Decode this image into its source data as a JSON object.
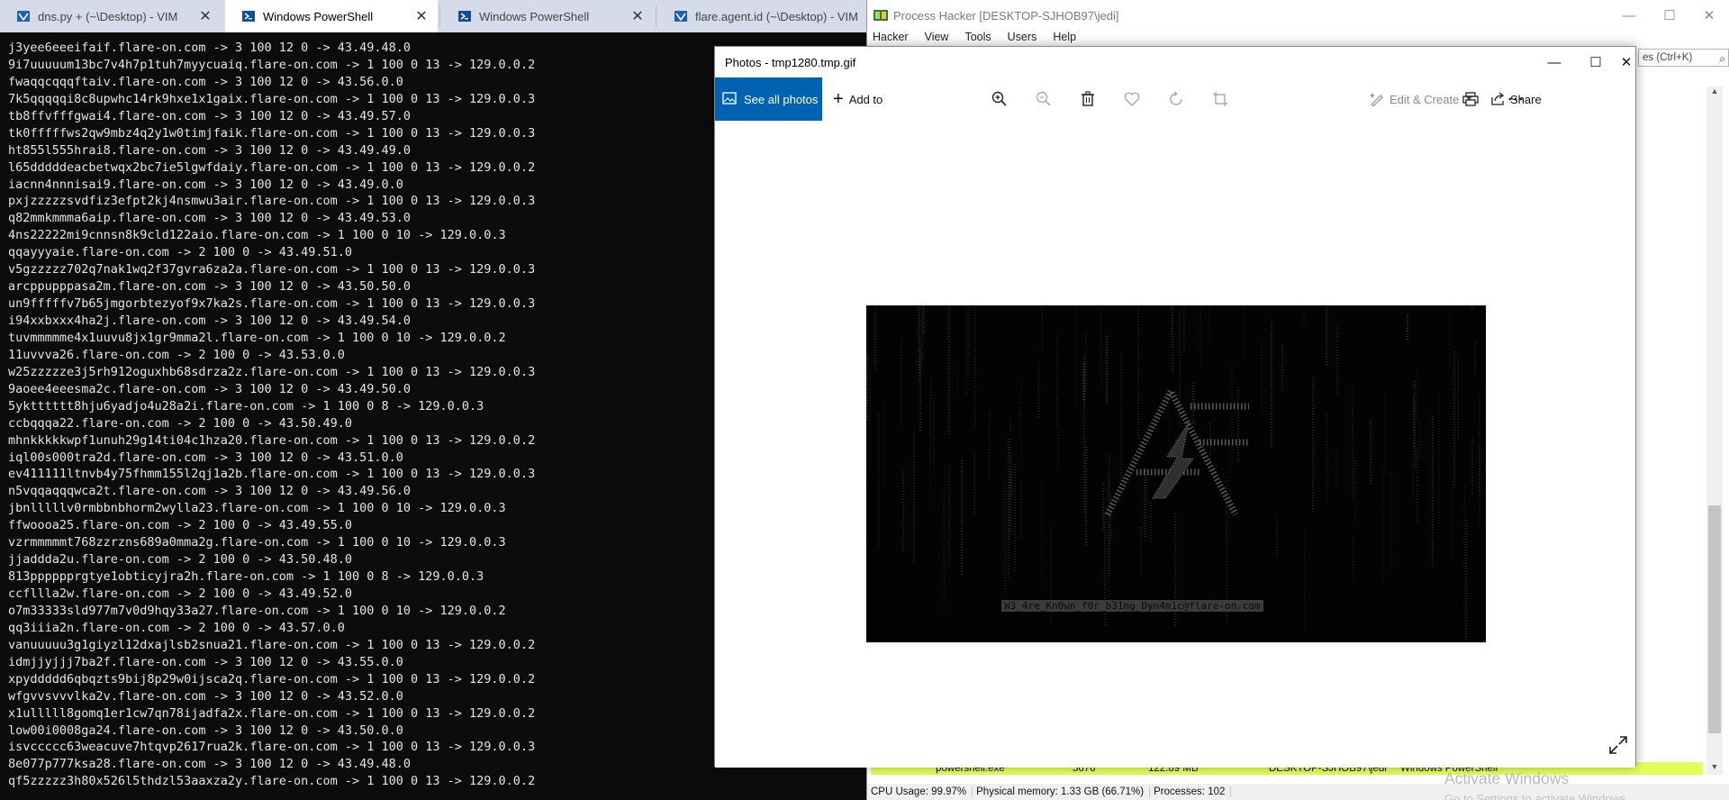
{
  "terminal_tabs": [
    {
      "title": "dns.py + (~\\Desktop) - VIM",
      "icon": "vim-icon",
      "active": false
    },
    {
      "title": "Windows PowerShell",
      "icon": "powershell-icon",
      "active": true
    },
    {
      "title": "Windows PowerShell",
      "icon": "powershell-icon",
      "active": false
    },
    {
      "title": "flare.agent.id (~\\Desktop) - VIM",
      "icon": "vim-icon",
      "active": false
    }
  ],
  "terminal": {
    "lines": [
      "j3yee6eeeifaif.flare-on.com -> 3 100 12 0 -> 43.49.48.0",
      "9i7uuuuum13bc7v4h7p1tuh7myycuaiq.flare-on.com -> 1 100 0 13 -> 129.0.0.2",
      "fwaqqcqqqftaiv.flare-on.com -> 3 100 12 0 -> 43.56.0.0",
      "7k5qqqqqi8c8upwhc14rk9hxe1x1gaix.flare-on.com -> 1 100 0 13 -> 129.0.0.3",
      "tb8ffvfffgwai4.flare-on.com -> 3 100 12 0 -> 43.49.57.0",
      "tk0fffffws2qw9mbz4q2y1w0timjfaik.flare-on.com -> 1 100 0 13 -> 129.0.0.3",
      "ht855l555hrai8.flare-on.com -> 3 100 12 0 -> 43.49.49.0",
      "l65dddddeacbetwqx2bc7ie5lgwfdaiy.flare-on.com -> 1 100 0 13 -> 129.0.0.2",
      "iacnn4nnnisai9.flare-on.com -> 3 100 12 0 -> 43.49.0.0",
      "pxjzzzzzsvdfiz3efpt2kj4nsmwu3air.flare-on.com -> 1 100 0 13 -> 129.0.0.3",
      "q82mmkmmma6aip.flare-on.com -> 3 100 12 0 -> 43.49.53.0",
      "4ns22222mi9cnnsn8k9cld122aio.flare-on.com -> 1 100 0 10 -> 129.0.0.3",
      "qqayyyaie.flare-on.com -> 2 100 0 -> 43.49.51.0",
      "v5gzzzzz702q7nak1wq2f37gvra6za2a.flare-on.com -> 1 100 0 13 -> 129.0.0.3",
      "arcppupppasa2m.flare-on.com -> 3 100 12 0 -> 43.50.50.0",
      "un9fffffv7b65jmgorbtezyof9x7ka2s.flare-on.com -> 1 100 0 13 -> 129.0.0.3",
      "i94xxbxxx4ha2j.flare-on.com -> 3 100 12 0 -> 43.49.54.0",
      "tuvmmmmme4x1uuvu8jx1gr9mma2l.flare-on.com -> 1 100 0 10 -> 129.0.0.2",
      "11uvvva26.flare-on.com -> 2 100 0 -> 43.53.0.0",
      "w25zzzzze3j5rh912oguxhb68sdrza2z.flare-on.com -> 1 100 0 13 -> 129.0.0.3",
      "9aoee4eeesma2c.flare-on.com -> 3 100 12 0 -> 43.49.50.0",
      "5yktttttt8hju6yadjo4u28a2i.flare-on.com -> 1 100 0 8 -> 129.0.0.3",
      "ccbqqqa22.flare-on.com -> 2 100 0 -> 43.50.49.0",
      "mhnkkkkkwpf1unuh29g14ti04c1hza20.flare-on.com -> 1 100 0 13 -> 129.0.0.2",
      "iql00s000tra2d.flare-on.com -> 3 100 12 0 -> 43.51.0.0",
      "ev411111ltnvb4y75fhmm155l2qj1a2b.flare-on.com -> 1 100 0 13 -> 129.0.0.3",
      "n5vqqaqqqwca2t.flare-on.com -> 3 100 12 0 -> 43.49.56.0",
      "jbnlllllv0rmbbnbhorm2wylla23.flare-on.com -> 1 100 0 10 -> 129.0.0.3",
      "ffwoooa25.flare-on.com -> 2 100 0 -> 43.49.55.0",
      "vzrmmmmmt768zzrzns689a0mma2g.flare-on.com -> 1 100 0 10 -> 129.0.0.3",
      "jjaddda2u.flare-on.com -> 2 100 0 -> 43.50.48.0",
      "813pppppprgtye1obticyjra2h.flare-on.com -> 1 100 0 8 -> 129.0.0.3",
      "ccfllla2w.flare-on.com -> 2 100 0 -> 43.49.52.0",
      "o7m33333sld977m7v0d9hqy33a27.flare-on.com -> 1 100 0 10 -> 129.0.0.2",
      "qq3iiia2n.flare-on.com -> 2 100 0 -> 43.57.0.0",
      "vanuuuuu3g1giyzl12dxajlsb2snua21.flare-on.com -> 1 100 0 13 -> 129.0.0.2",
      "idmjjyjjj7ba2f.flare-on.com -> 3 100 12 0 -> 43.55.0.0",
      "xpyddddd6qbqzts9bij8p29w0ijsca2q.flare-on.com -> 1 100 0 13 -> 129.0.0.2",
      "wfgvvsvvvlka2v.flare-on.com -> 3 100 12 0 -> 43.52.0.0",
      "x1ulllll8gomq1er1cw7qn78ijadfa2x.flare-on.com -> 1 100 0 13 -> 129.0.0.2",
      "low00i0008ga24.flare-on.com -> 3 100 12 0 -> 43.50.0.0",
      "isvccccc63weacuve7htqvp2617rua2k.flare-on.com -> 1 100 0 13 -> 129.0.0.3",
      "8e077p777ksa28.flare-on.com -> 3 100 12 0 -> 43.49.48.0",
      "qf5zzzzz3h80x526l5thdzl53aaxza2y.flare-on.com -> 1 100 0 13 -> 129.0.0.2"
    ]
  },
  "process_hacker": {
    "title": "Process Hacker [DESKTOP-SJHOB97\\jedi]",
    "menu": [
      "Hacker",
      "View",
      "Tools",
      "Users",
      "Help"
    ],
    "search_text": "es (Ctrl+K)",
    "row": {
      "name": "powershell.exe",
      "pid": "5676",
      "memory": "122.89 MB",
      "user": "DESKTOP-SJHOB97\\jedi",
      "description": "Windows PowerShell"
    },
    "status": {
      "cpu": "CPU Usage: 99.97%",
      "memory": "Physical memory: 1.33 GB (66.71%)",
      "processes": "Processes: 102"
    }
  },
  "photos": {
    "title": "Photos - tmp1280.tmp.gif",
    "see_all_label": "See all photos",
    "add_to_label": "Add to",
    "edit_create_label": "Edit & Create",
    "share_label": "Share",
    "toolbar_icons": [
      "zoom-in-icon",
      "zoom-out-icon",
      "delete-icon",
      "favorite-icon",
      "rotate-icon",
      "crop-icon"
    ],
    "image_flag_text": "W3_4re_Kn0wn_f0r_b31ng_Dyn4m1c@flare-on.com"
  },
  "activate_windows": {
    "title": "Activate Windows",
    "subtitle": "Go to Settings to activate Windows."
  },
  "colors": {
    "accent": "#0063b1",
    "terminal_bg": "#0c0c0c",
    "terminal_text": "#e4e4e4",
    "ph_highlight_row": "#e2ff59"
  }
}
